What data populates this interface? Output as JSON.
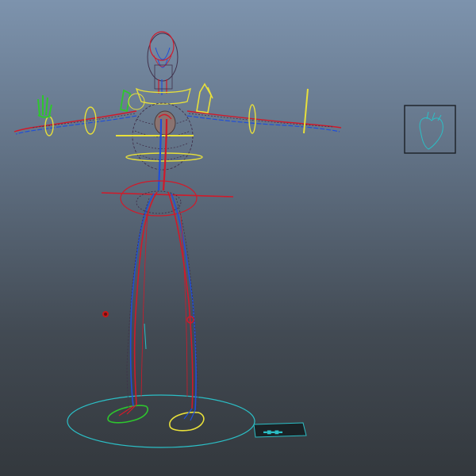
{
  "viewport": {
    "background_top": "#7d93ad",
    "background_bottom": "#33383d"
  },
  "colors": {
    "artery": "#d01a2a",
    "vein": "#1f4fd8",
    "nerve_control": "#e8e03a",
    "ik_control": "#2ec62e",
    "ground_control": "#2bbfc6",
    "camera_gate": "#1b1f25",
    "dark_wire": "#40304a"
  },
  "icons": {
    "heart_thumbnail": "heart-icon",
    "selection_handle": "circle-handle-icon",
    "logo_plate": "logo-plate-icon"
  }
}
